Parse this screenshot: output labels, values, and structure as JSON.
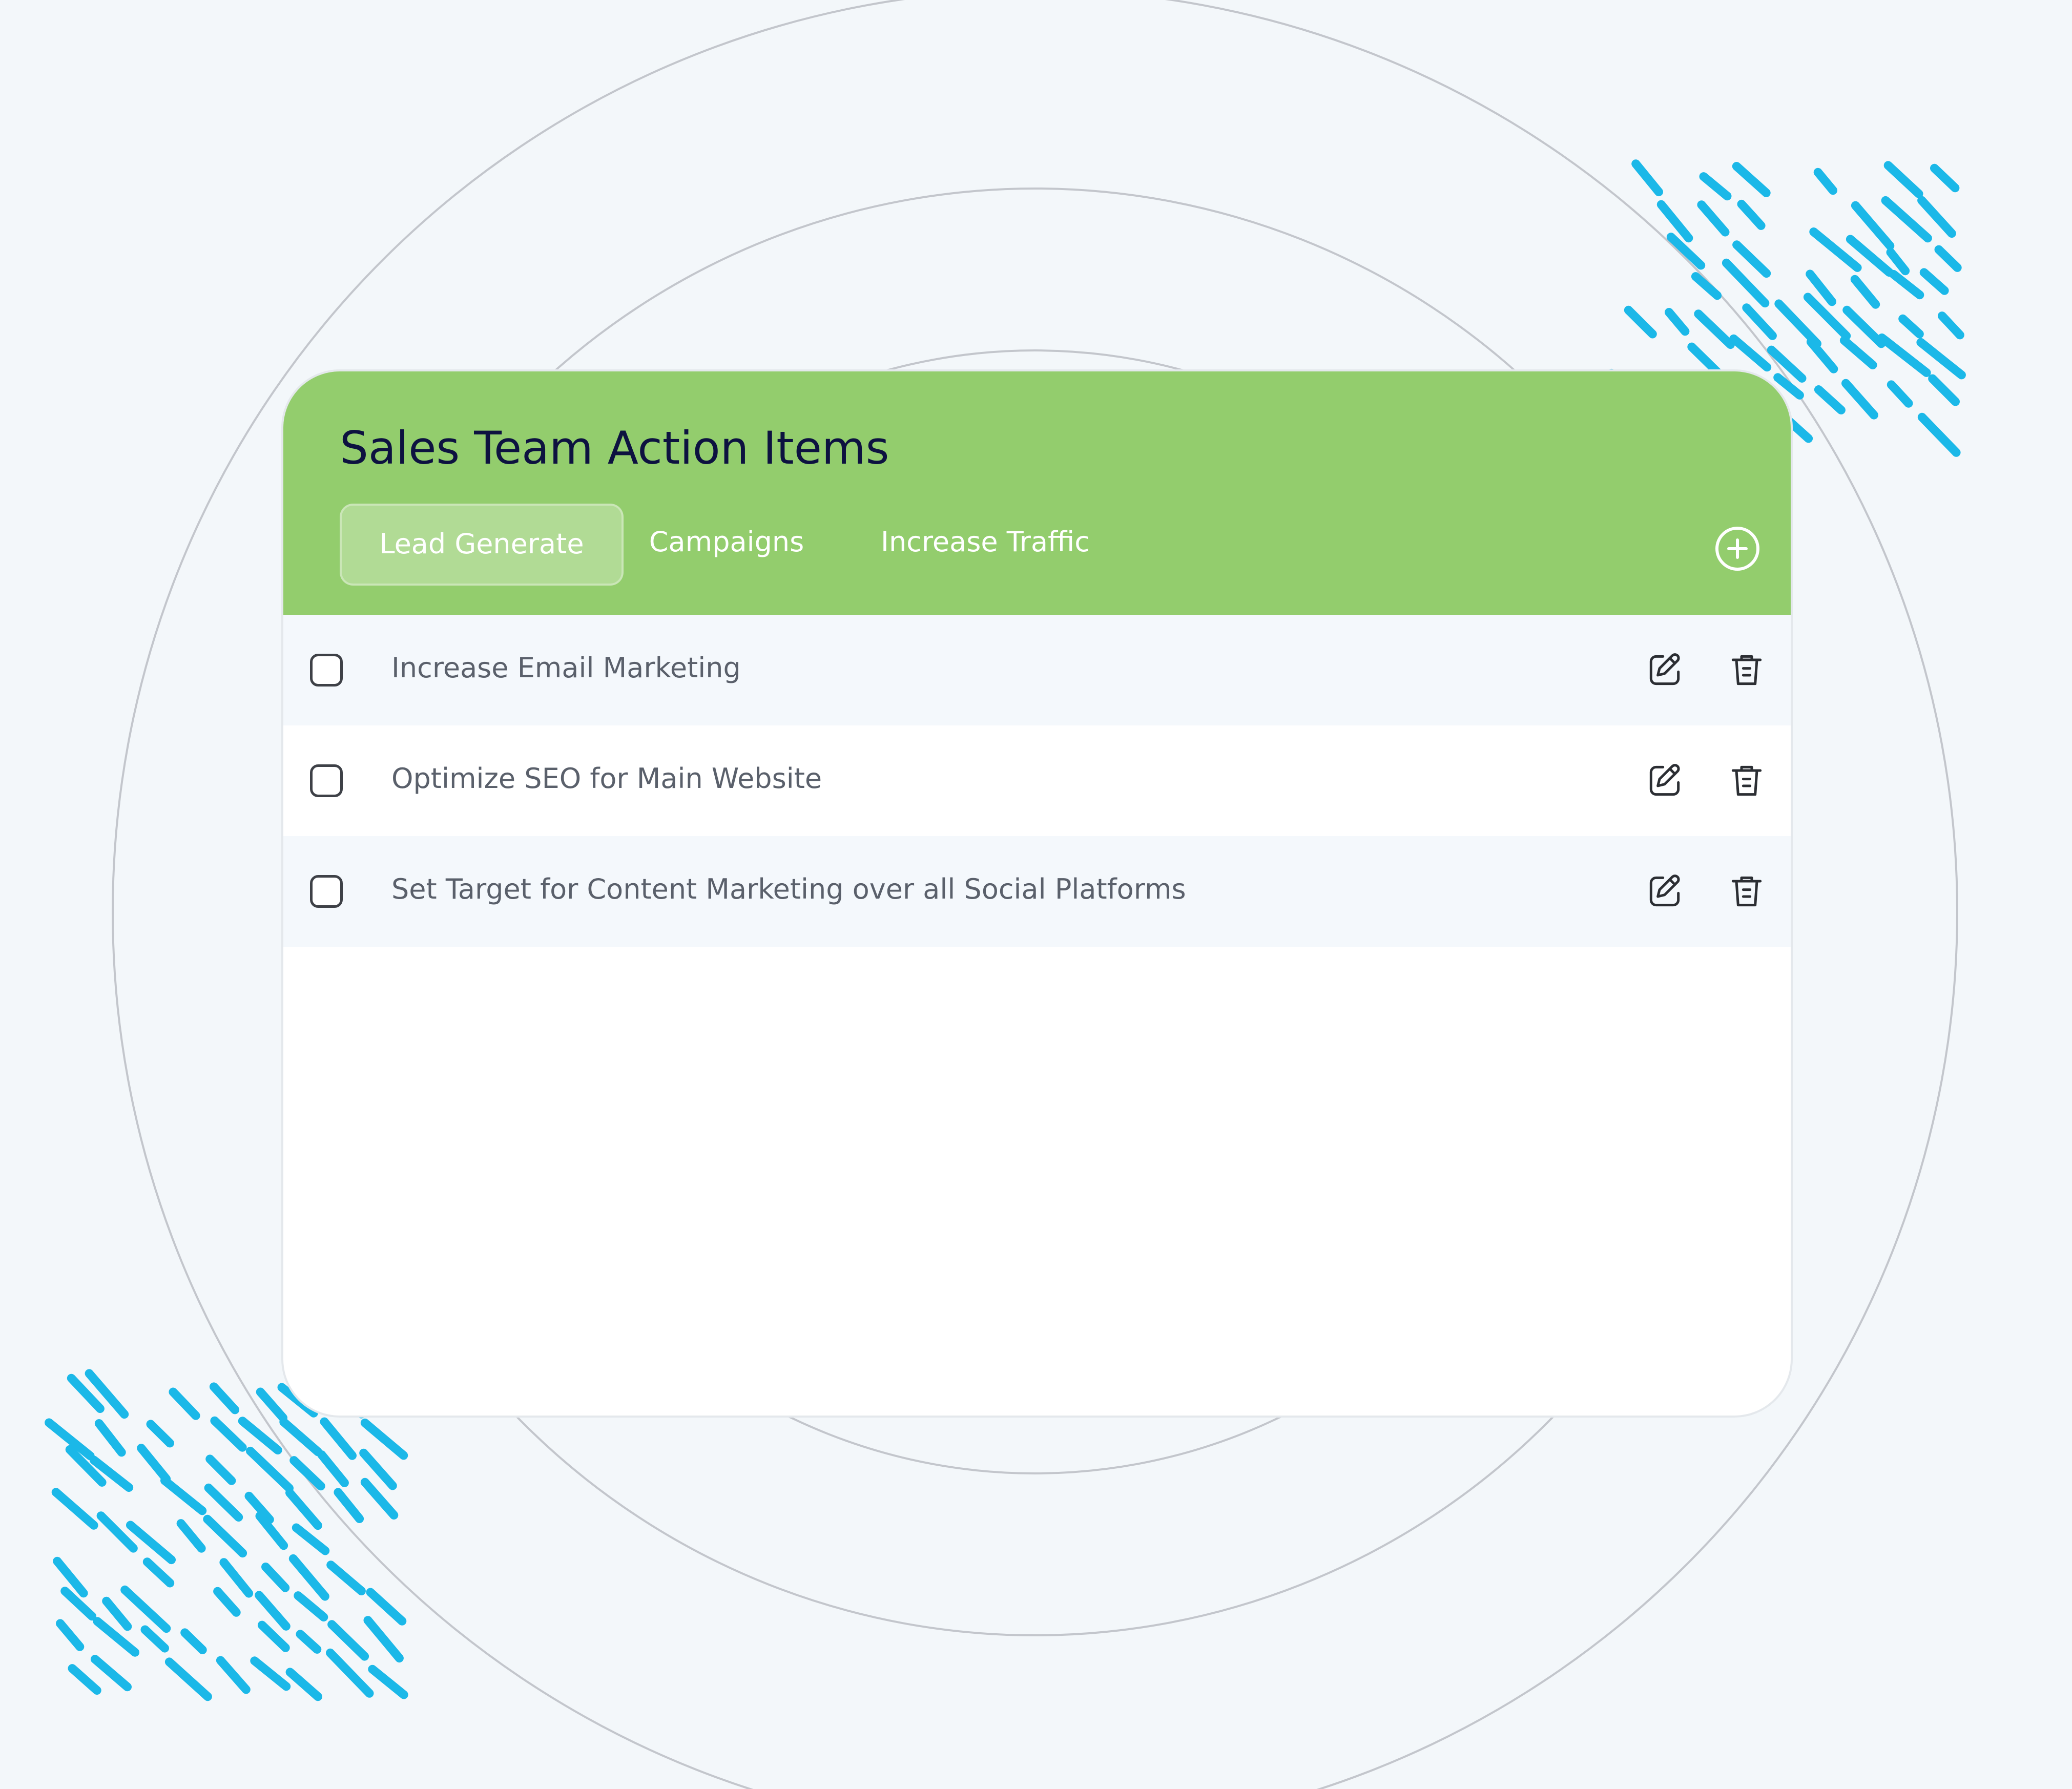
{
  "card": {
    "title": "Sales Team Action Items",
    "add_icon": "plus-circle-icon"
  },
  "tabs": [
    {
      "label": "Lead Generate",
      "active": true
    },
    {
      "label": "Campaigns",
      "active": false
    },
    {
      "label": "Increase Traffic",
      "active": false
    }
  ],
  "tasks": [
    {
      "label": "Increase Email Marketing",
      "checked": false,
      "edit_icon": "edit-icon",
      "delete_icon": "trash-icon"
    },
    {
      "label": "Optimize SEO for Main Website",
      "checked": false,
      "edit_icon": "edit-icon",
      "delete_icon": "trash-icon"
    },
    {
      "label": "Set Target for Content Marketing over all Social Platforms",
      "checked": false,
      "edit_icon": "edit-icon",
      "delete_icon": "trash-icon"
    }
  ],
  "colors": {
    "background": "#f3f7fa",
    "header": "#93cd6d",
    "title": "#0d1240",
    "row_alt": "#f4f8fc",
    "task_text": "#5a606b",
    "decor_dashes": "#1bb8e8",
    "rings": "#c3c6cc"
  }
}
